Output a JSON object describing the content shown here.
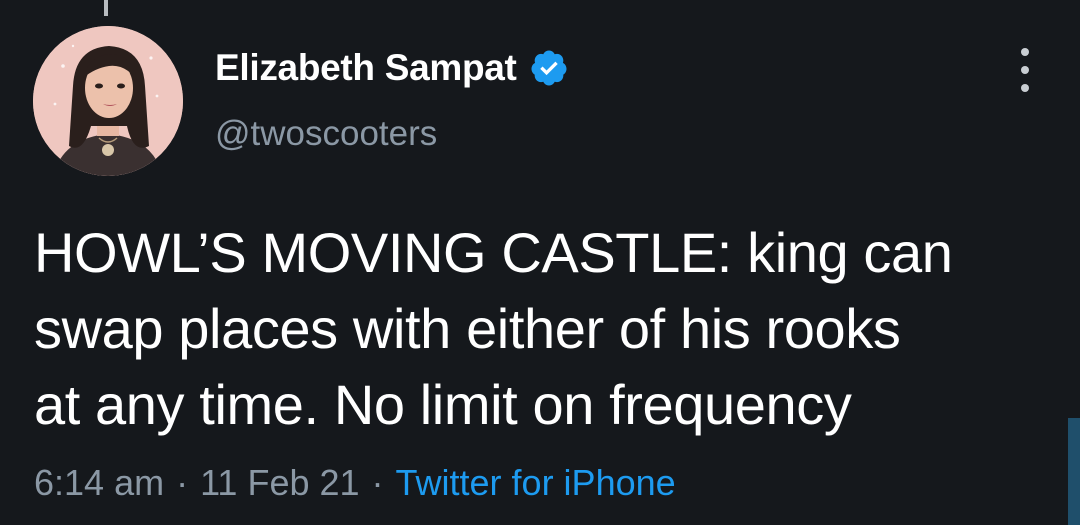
{
  "tweet": {
    "author": {
      "display_name": "Elizabeth Sampat",
      "handle": "@twoscooters",
      "verified": true
    },
    "text_lines": [
      "HOWL’S MOVING CASTLE: king can",
      "swap places with either of his rooks",
      "at any time. No limit on frequency"
    ],
    "time": "6:14 am",
    "date": "11 Feb 21",
    "source": "Twitter for iPhone",
    "separator": "·"
  },
  "icons": {
    "verified": "verified-badge-icon",
    "more": "more-vertical-icon"
  },
  "colors": {
    "background": "#15181c",
    "primary_text": "#ffffff",
    "secondary_text": "#8b98a5",
    "link": "#1d9bf0",
    "verified_badge": "#1d9bf0"
  }
}
